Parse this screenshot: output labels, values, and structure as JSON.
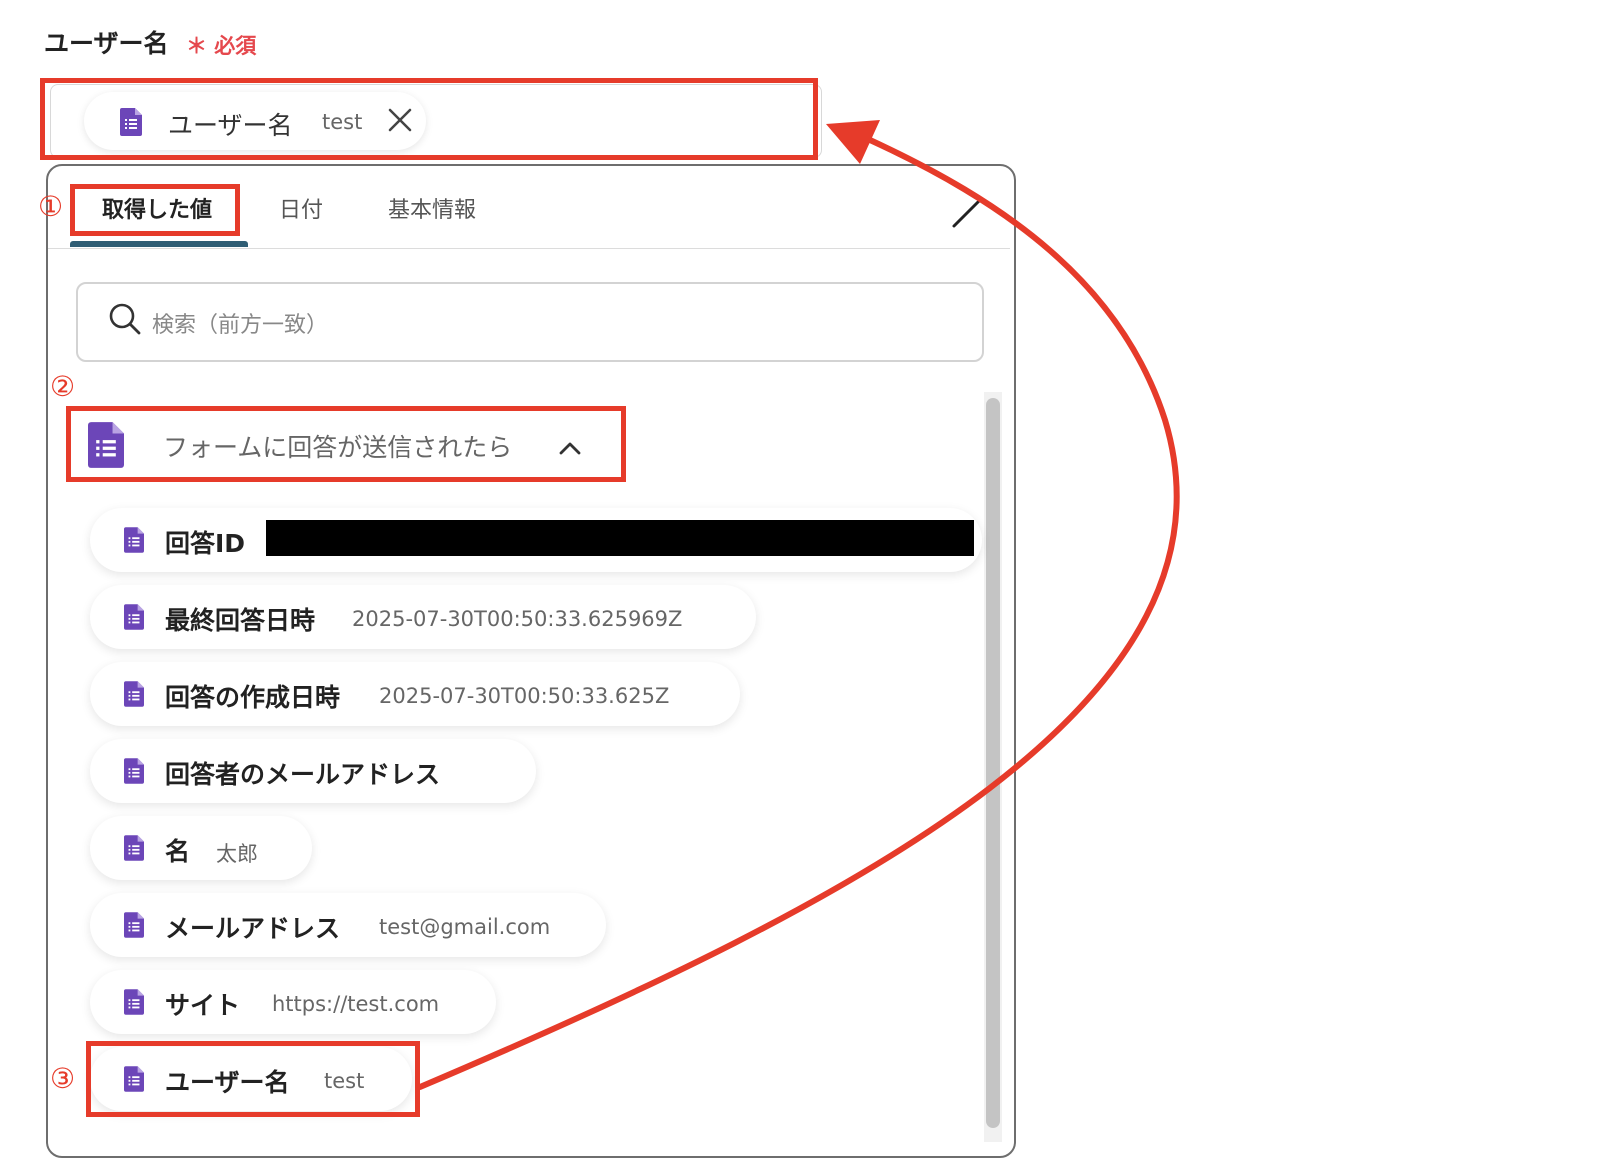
{
  "field": {
    "label": "ユーザー名",
    "required": "＊ 必須",
    "token": {
      "label": "ユーザー名",
      "value": "test"
    }
  },
  "tabs": [
    "取得した値",
    "日付",
    "基本情報"
  ],
  "search": {
    "placeholder": "検索（前方一致）"
  },
  "group": {
    "title": "フォームに回答が送信されたら"
  },
  "items": [
    {
      "label": "回答ID",
      "value": ""
    },
    {
      "label": "最終回答日時",
      "value": "2025-07-30T00:50:33.625969Z"
    },
    {
      "label": "回答の作成日時",
      "value": "2025-07-30T00:50:33.625Z"
    },
    {
      "label": "回答者のメールアドレス",
      "value": ""
    },
    {
      "label": "名",
      "value": "太郎"
    },
    {
      "label": "メールアドレス",
      "value": "test@gmail.com"
    },
    {
      "label": "サイト",
      "value": "https://test.com"
    },
    {
      "label": "ユーザー名",
      "value": "test"
    }
  ],
  "annotations": {
    "step1": "①",
    "step2": "②",
    "step3": "③"
  },
  "icons": {
    "form": "google-forms-icon",
    "search": "search-icon",
    "close": "close-icon",
    "chevron": "chevron-up-icon"
  },
  "colors": {
    "highlight": "#e63b2a",
    "accent_tab": "#2f5d74",
    "forms_purple": "#6c46b8",
    "required": "#e5484d"
  }
}
